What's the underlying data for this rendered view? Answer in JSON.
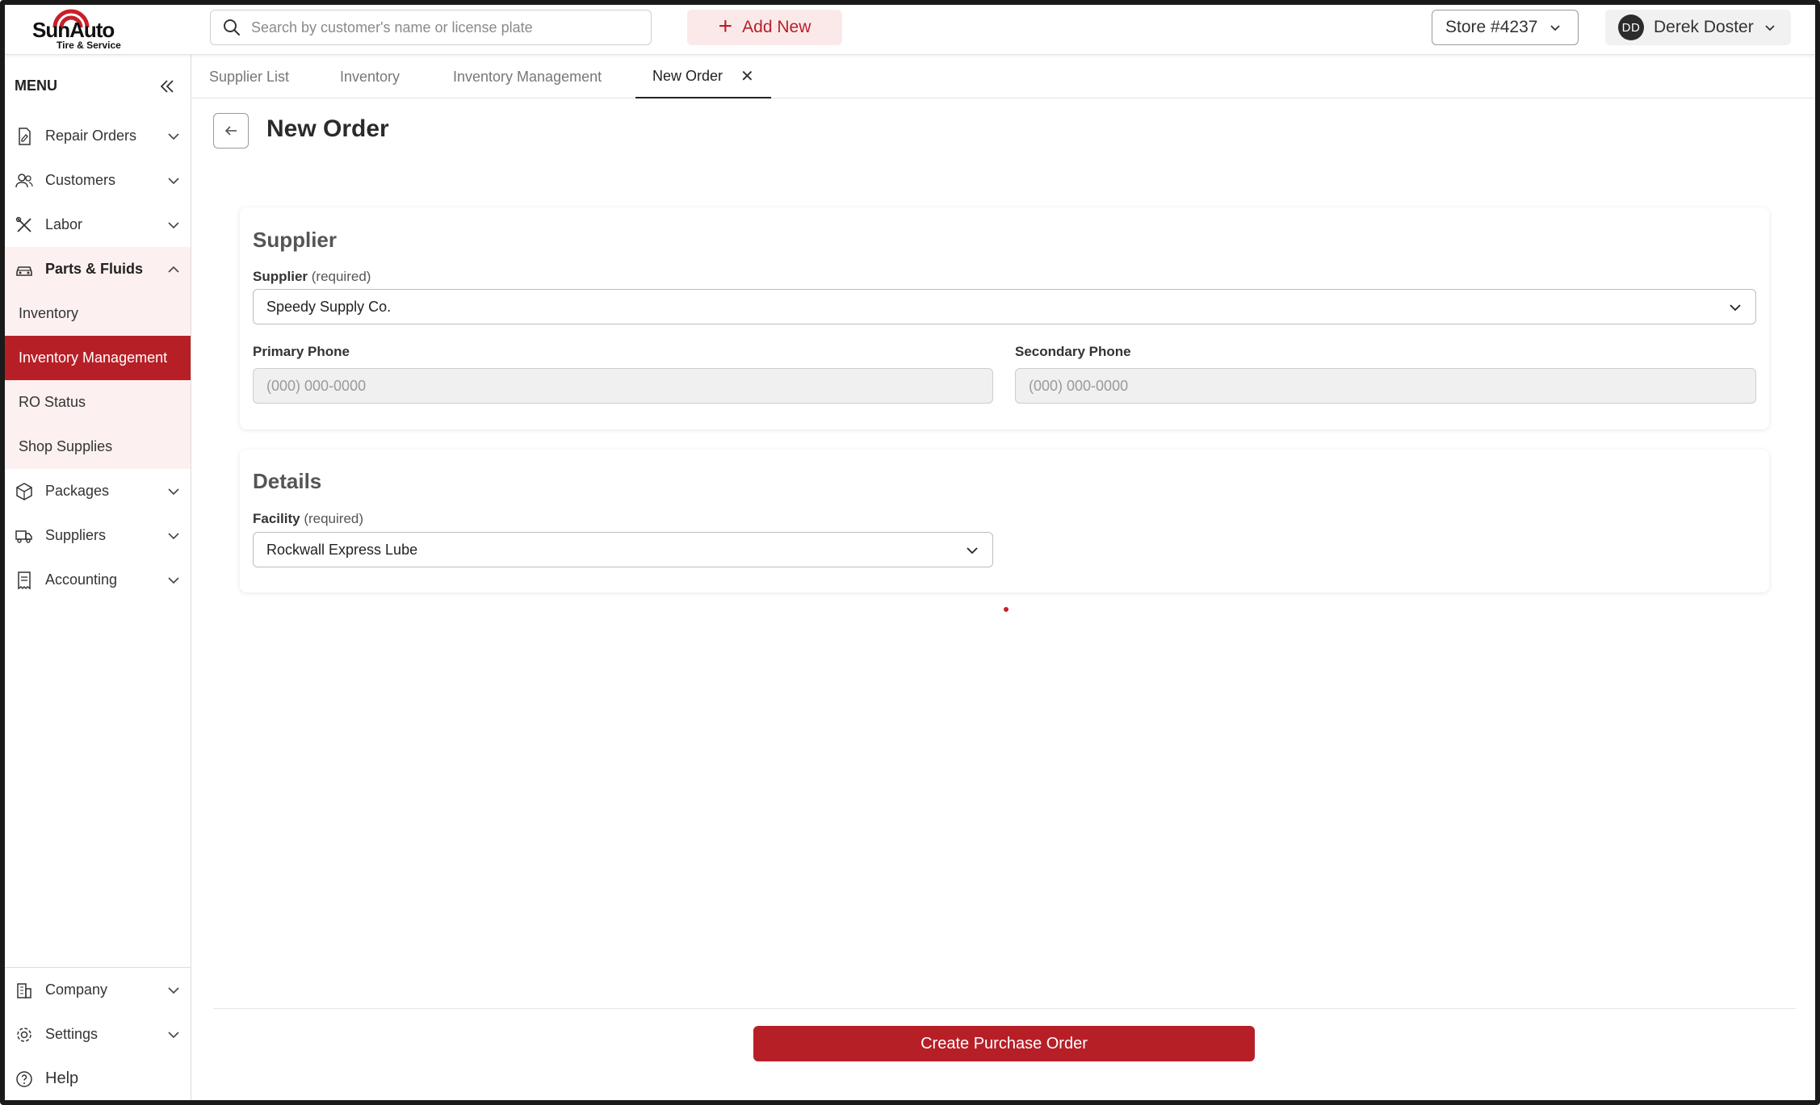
{
  "header": {
    "logo": {
      "brand": "SunAuto",
      "tagline": "Tire & Service"
    },
    "search": {
      "placeholder": "Search by customer's name or license plate"
    },
    "add_new_label": "Add New",
    "store_label": "Store #4237",
    "user": {
      "initials": "DD",
      "name": "Derek Doster"
    }
  },
  "sidebar": {
    "menu_label": "MENU",
    "items": [
      {
        "label": "Repair Orders",
        "icon": "document-pen-icon"
      },
      {
        "label": "Customers",
        "icon": "users-icon"
      },
      {
        "label": "Labor",
        "icon": "tools-icon"
      },
      {
        "label": "Parts & Fluids",
        "icon": "car-icon",
        "expanded": true,
        "children": [
          {
            "label": "Inventory"
          },
          {
            "label": "Inventory Management",
            "active": true
          },
          {
            "label": "RO Status"
          },
          {
            "label": "Shop Supplies"
          }
        ]
      },
      {
        "label": "Packages",
        "icon": "box-icon"
      },
      {
        "label": "Suppliers",
        "icon": "truck-icon"
      },
      {
        "label": "Accounting",
        "icon": "receipt-icon"
      }
    ],
    "bottom": [
      {
        "label": "Company",
        "icon": "building-icon"
      },
      {
        "label": "Settings",
        "icon": "gear-icon"
      },
      {
        "label": "Help",
        "icon": "help-icon"
      }
    ]
  },
  "tabs": [
    {
      "label": "Supplier List"
    },
    {
      "label": "Inventory"
    },
    {
      "label": "Inventory Management"
    },
    {
      "label": "New Order",
      "active": true,
      "closable": true
    }
  ],
  "page": {
    "title": "New Order",
    "supplier_section": {
      "title": "Supplier",
      "supplier_label": "Supplier",
      "required_text": "(required)",
      "supplier_value": "Speedy Supply Co.",
      "primary_phone_label": "Primary Phone",
      "primary_phone_placeholder": "(000) 000-0000",
      "secondary_phone_label": "Secondary Phone",
      "secondary_phone_placeholder": "(000) 000-0000"
    },
    "details_section": {
      "title": "Details",
      "facility_label": "Facility",
      "required_text": "(required)",
      "facility_value": "Rockwall Express Lube"
    },
    "submit_label": "Create Purchase Order"
  },
  "colors": {
    "brand_red": "#b71f27",
    "active_tint": "#fdf0f0",
    "add_new_bg": "#fbe9ea"
  }
}
